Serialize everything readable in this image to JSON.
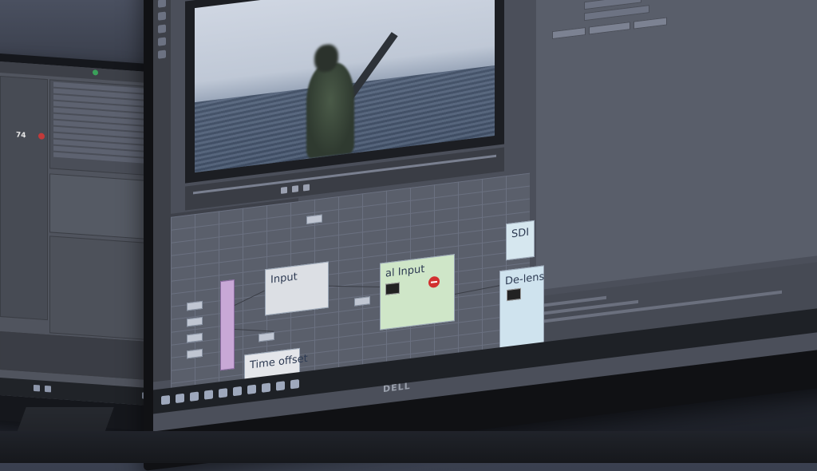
{
  "scene": {
    "left_monitor": {
      "frame_counter": "74"
    },
    "main_monitor": {
      "brand": "DELL",
      "node_graph": {
        "nodes": [
          {
            "id": "input",
            "label": "Input"
          },
          {
            "id": "digital-input",
            "label": "al Input"
          },
          {
            "id": "time-offset",
            "label": "Time offset"
          },
          {
            "id": "sdi",
            "label": "SDI"
          },
          {
            "id": "delens",
            "label": "De-lens"
          }
        ]
      }
    }
  }
}
